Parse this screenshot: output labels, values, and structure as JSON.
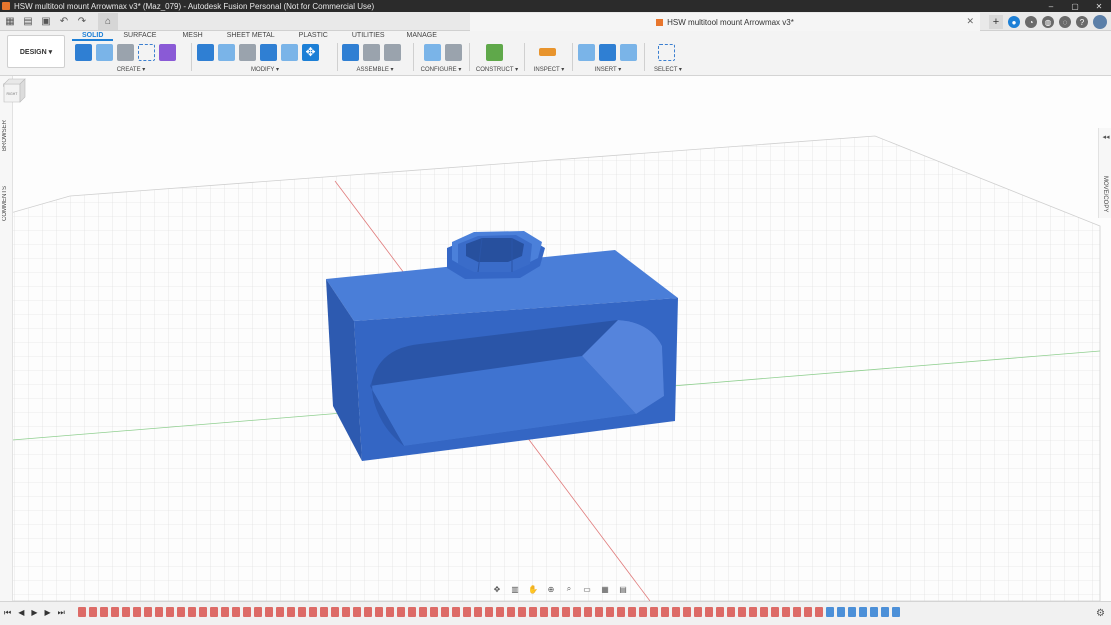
{
  "window": {
    "title": "HSW multitool mount Arrowmax v3* (Maz_079) - Autodesk Fusion Personal (Not for Commercial Use)",
    "minimize": "–",
    "maximize": "▢",
    "close": "✕"
  },
  "document_tab": {
    "label": "HSW multitool mount Arrowmax v3*",
    "close": "✕"
  },
  "ribbon": {
    "workspace": "DESIGN ▾",
    "tabs": [
      "SOLID",
      "SURFACE",
      "MESH",
      "SHEET METAL",
      "PLASTIC",
      "UTILITIES",
      "MANAGE"
    ],
    "active_tab": "SOLID",
    "groups": {
      "create": "CREATE ▾",
      "modify": "MODIFY ▾",
      "assemble": "ASSEMBLE ▾",
      "configure": "CONFIGURE ▾",
      "construct": "CONSTRUCT ▾",
      "inspect": "INSPECT ▾",
      "insert": "INSERT ▾",
      "select": "SELECT ▾"
    }
  },
  "panels": {
    "browser": "BROWSER",
    "comments": "COMMENTS",
    "move_copy": "MOVE/COPY"
  },
  "viewcube": {
    "face": "RIGHT"
  },
  "colors": {
    "model_blue": "#3b6fcf",
    "accent": "#1c7fd6",
    "grid": "#d9d9d9",
    "x_axis": "#e07b7b",
    "y_axis": "#8fcf8f"
  }
}
